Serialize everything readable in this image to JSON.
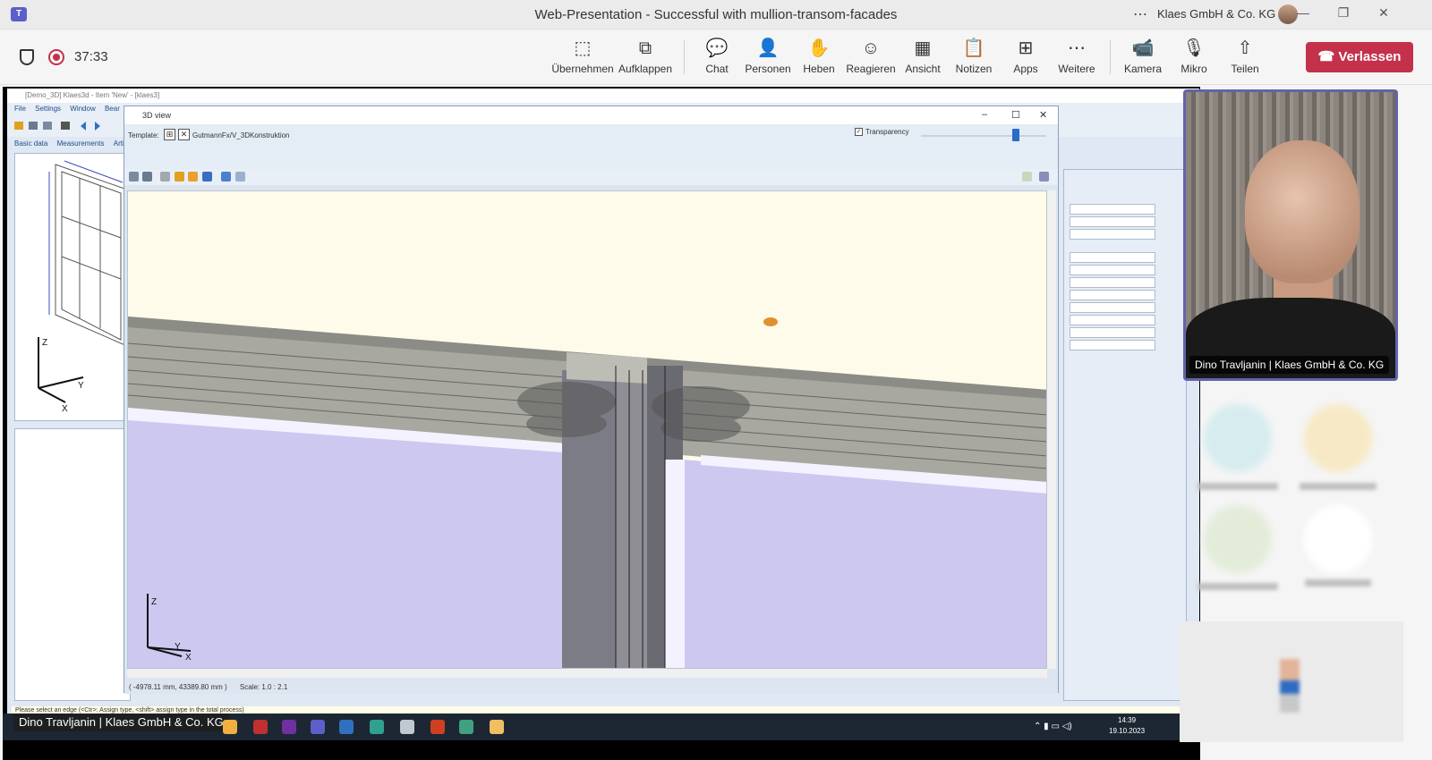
{
  "window": {
    "title": "Web-Presentation - Successful with mullion-transom-facades",
    "org": "Klaes GmbH & Co. KG",
    "more_icon": "ellipsis-icon"
  },
  "meeting": {
    "timer": "37:33",
    "tools": [
      {
        "label": "Übernehmen",
        "icon": "⬚"
      },
      {
        "label": "Aufklappen",
        "icon": "⧉"
      },
      {
        "label": "Chat",
        "icon": "💬"
      },
      {
        "label": "Personen",
        "icon": "👤"
      },
      {
        "label": "Heben",
        "icon": "✋"
      },
      {
        "label": "Reagieren",
        "icon": "☺"
      },
      {
        "label": "Ansicht",
        "icon": "▦"
      },
      {
        "label": "Notizen",
        "icon": "📋"
      },
      {
        "label": "Apps",
        "icon": "⊞"
      },
      {
        "label": "Weitere",
        "icon": "⋯"
      },
      {
        "label": "Kamera",
        "icon": "📹"
      },
      {
        "label": "Mikro",
        "icon": "🎙"
      },
      {
        "label": "Teilen",
        "icon": "⇧"
      }
    ],
    "leave_label": "Verlassen",
    "leave_color": "#c4314b"
  },
  "app": {
    "title": "[Demo_3D] Klaes3d - Item 'New' - [klaes3]",
    "menu": [
      "File",
      "Settings",
      "Window",
      "Bear"
    ],
    "tabs": [
      "Basic data",
      "Measurements",
      "Artic"
    ],
    "status_hint": "Please select an edge (<Ctr>: Assign type, <shift> assign type in the total  process)"
  },
  "view3d": {
    "title": "3D view",
    "template_label": "Template:",
    "template_name": "GutmannFx/V_3DKonstruktion",
    "transparency_label": "Transparency",
    "transparency_checked": "✓",
    "transparency_level": 0.75,
    "coords": "( -4978.11 mm, 43389.80 mm )",
    "scale": "Scale: 1.0 : 2.1",
    "axis_z": "Z",
    "axis_y": "Y",
    "axis_x": "X"
  },
  "left_axes": {
    "z": "Z",
    "y": "Y",
    "x": "X"
  },
  "taskbar": {
    "presenter": "Dino Travljanin | Klaes GmbH & Co. KG",
    "time": "14:39",
    "date": "19.10.2023"
  },
  "participants": {
    "speaker_name": "Dino Travljanin | Klaes GmbH & Co. KG",
    "accent": "#6264a7"
  }
}
